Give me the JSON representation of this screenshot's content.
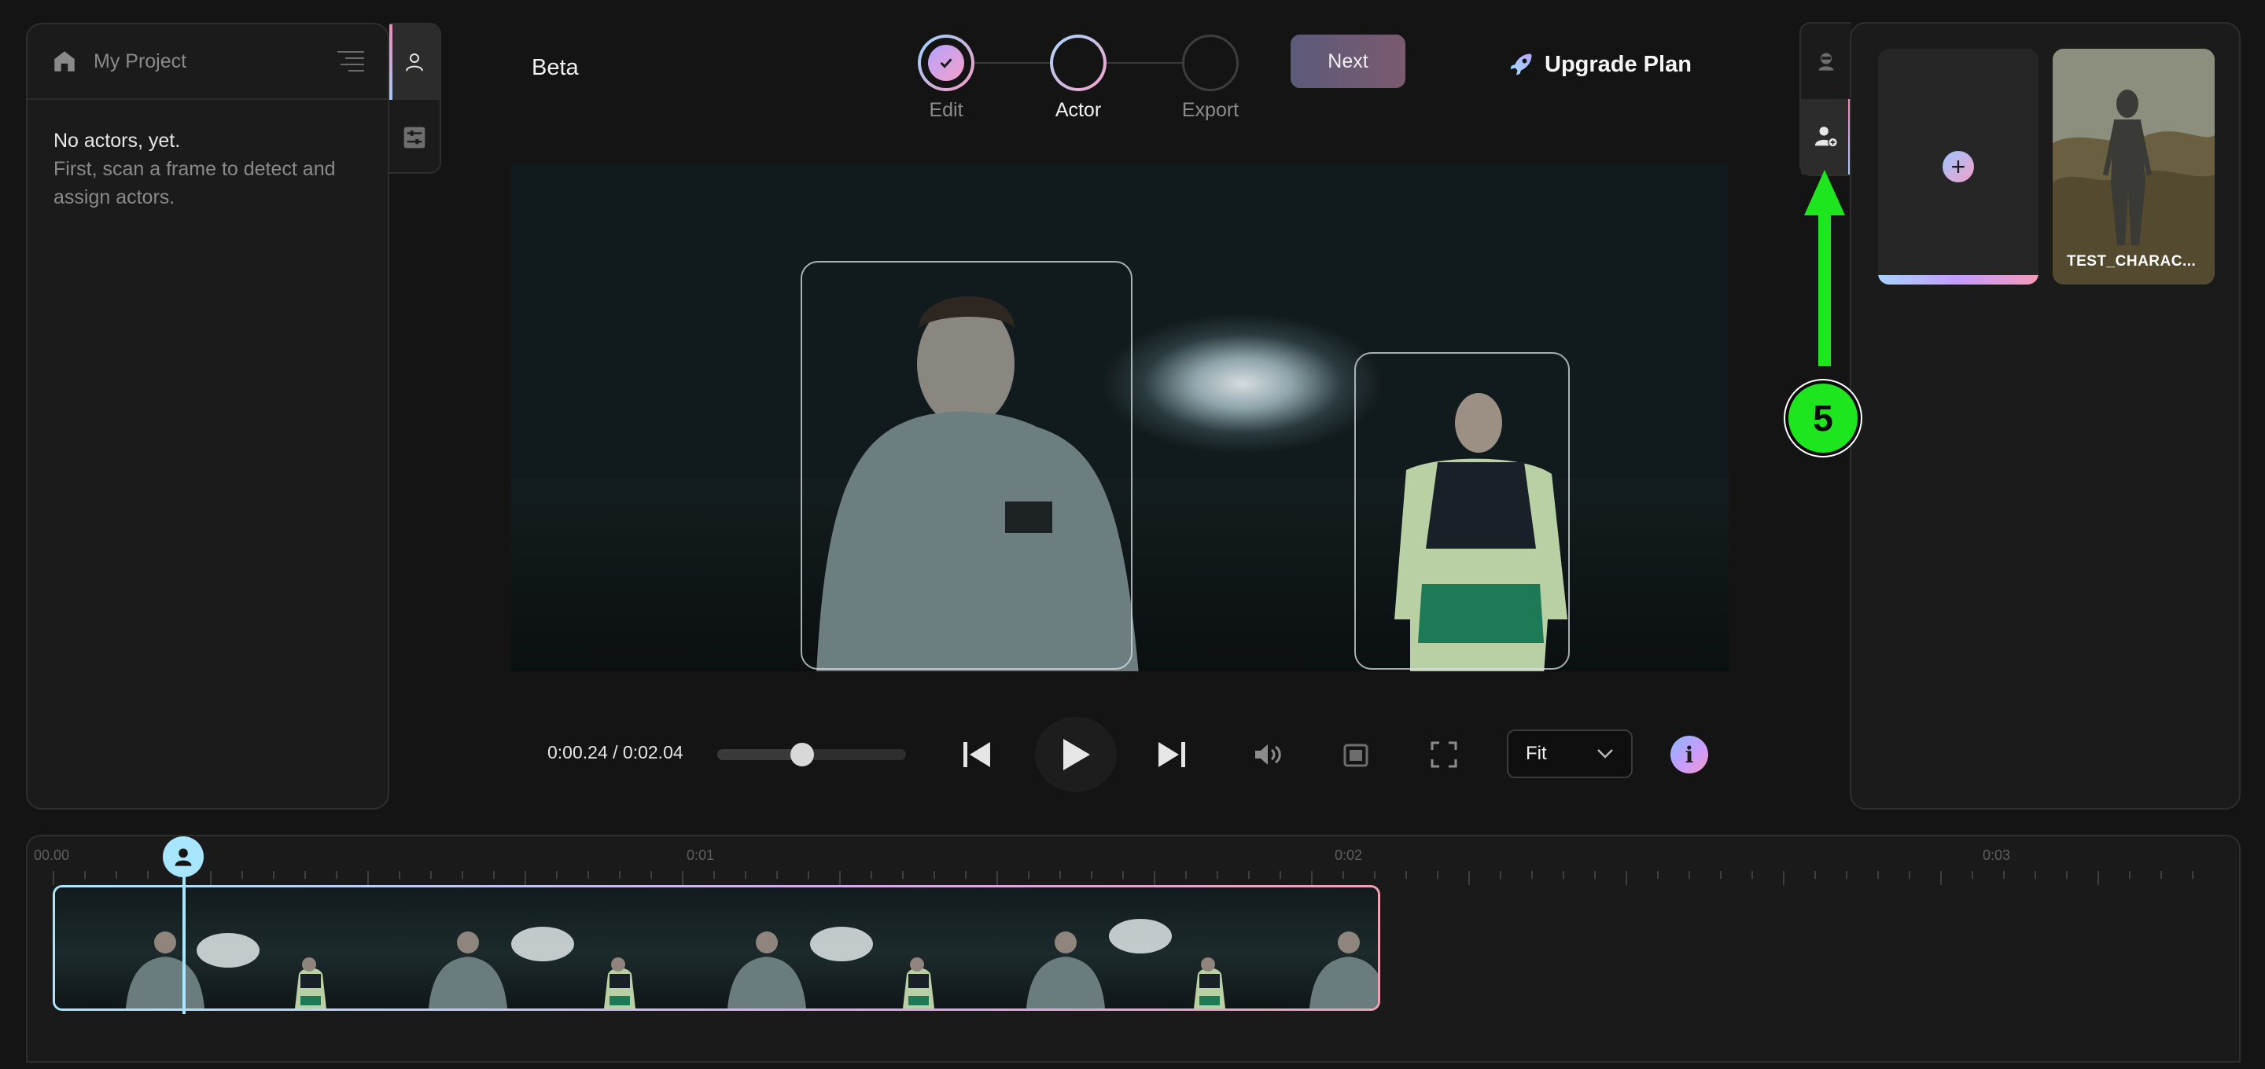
{
  "project": {
    "name": "My Project"
  },
  "actors_panel": {
    "empty_title": "No actors, yet.",
    "empty_description": "First, scan a frame to detect and assign actors."
  },
  "header": {
    "beta_label": "Beta",
    "steps": [
      {
        "label": "Edit",
        "state": "done"
      },
      {
        "label": "Actor",
        "state": "current"
      },
      {
        "label": "Export",
        "state": "pending"
      }
    ],
    "next_label": "Next",
    "upgrade_label": "Upgrade Plan"
  },
  "player": {
    "time": "0:00.24 / 0:02.04",
    "progress": 0.45,
    "fit_value": "Fit",
    "info_glyph": "i"
  },
  "characters": {
    "items": [
      {
        "label": "TEST_CHARAC..."
      }
    ]
  },
  "annotation": {
    "number": "5"
  },
  "timeline": {
    "ticks": [
      "00.00",
      "0:01",
      "0:02",
      "0:03"
    ]
  },
  "icons": {
    "home": "home-icon",
    "menu": "menu-lines-icon",
    "actor_tab": "person-icon",
    "adjust_tab": "sliders-icon",
    "upgrade": "rocket-icon",
    "play": "play-icon",
    "skip_back": "skip-back-icon",
    "skip_forward": "skip-forward-icon",
    "volume": "volume-icon",
    "pip": "picture-in-picture-icon",
    "fullscreen": "fullscreen-icon"
  },
  "colors": {
    "accent_gradient_start": "#a8e6ff",
    "accent_gradient_end": "#f2a0b4",
    "annotation": "#1ee61e"
  }
}
